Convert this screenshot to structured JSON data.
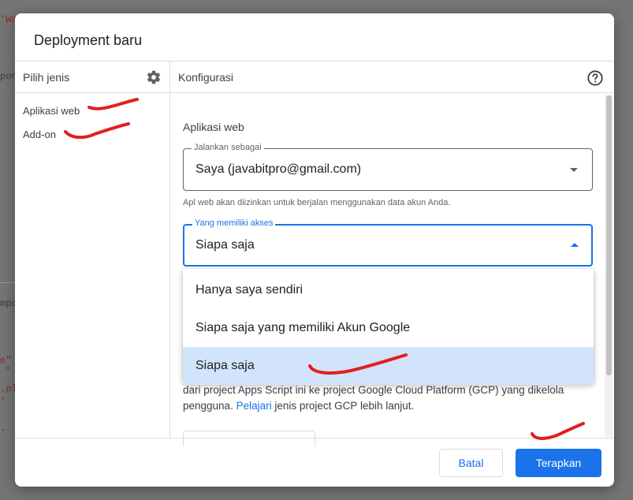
{
  "background": {
    "code_fragments": [
      "'Wa",
      "pon",
      "mpo",
      "e\"",
      "\"",
      ".pl",
      "'",
      "."
    ]
  },
  "dialog": {
    "title": "Deployment baru",
    "left_panel": {
      "header": "Pilih jenis",
      "types": [
        "Aplikasi web",
        "Add-on"
      ]
    },
    "right_panel": {
      "header": "Konfigurasi",
      "section_title": "Aplikasi web",
      "execute_as": {
        "legend": "Jalankan sebagai",
        "value": "Saya (javabitpro@gmail.com)",
        "hint": "Apl web akan diizinkan untuk berjalan menggunakan data akun Anda."
      },
      "access": {
        "legend": "Yang memiliki akses",
        "value": "Siapa saja",
        "options": [
          "Hanya saya sendiri",
          "Siapa saja yang memiliki Akun Google",
          "Siapa saja"
        ],
        "selected_index": 2
      },
      "description_partial": "dari project Apps Script ini ke project Google Cloud Platform (GCP) yang dikelola",
      "description_line2_prefix": "pengguna.",
      "learn_link": "Pelajari",
      "description_line2_suffix": "jenis project GCP lebih lanjut."
    },
    "footer": {
      "cancel_label": "Batal",
      "apply_label": "Terapkan"
    }
  },
  "colors": {
    "accent": "#1a73e8",
    "annotation": "#e02020",
    "selected_bg": "#d2e3fc"
  }
}
